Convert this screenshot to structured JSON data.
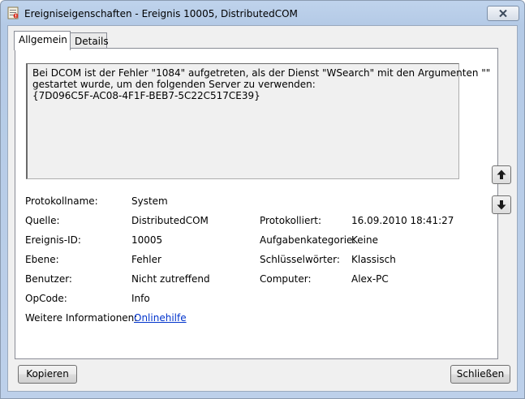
{
  "window": {
    "title": "Ereigniseigenschaften - Ereignis 10005, DistributedCOM"
  },
  "tabs": [
    {
      "label": "Allgemein",
      "active": true
    },
    {
      "label": "Details",
      "active": false
    }
  ],
  "description": {
    "lines": [
      "Bei DCOM ist der Fehler \"1084\" aufgetreten, als der Dienst \"WSearch\" mit den Argumenten \"\"",
      "gestartet wurde, um den folgenden Server zu verwenden:",
      "{7D096C5F-AC08-4F1F-BEB7-5C22C517CE39}"
    ]
  },
  "fields": {
    "protokollname": {
      "label": "Protokollname:",
      "value": "System"
    },
    "quelle": {
      "label": "Quelle:",
      "value": "DistributedCOM"
    },
    "ereignis_id": {
      "label": "Ereignis-ID:",
      "value": "10005"
    },
    "ebene": {
      "label": "Ebene:",
      "value": "Fehler"
    },
    "benutzer": {
      "label": "Benutzer:",
      "value": "Nicht zutreffend"
    },
    "opcode": {
      "label": "OpCode:",
      "value": "Info"
    },
    "weitere": {
      "label": "Weitere Informationen:",
      "value": "Onlinehilfe"
    },
    "protokolliert": {
      "label": "Protokolliert:",
      "value": "16.09.2010 18:41:27"
    },
    "aufgabenkategorie": {
      "label": "Aufgabenkategorie:",
      "value": "Keine"
    },
    "schluesselwoerter": {
      "label": "Schlüsselwörter:",
      "value": "Klassisch"
    },
    "computer": {
      "label": "Computer:",
      "value": "Alex-PC"
    }
  },
  "buttons": {
    "copy": "Kopieren",
    "close": "Schließen"
  },
  "icons": {
    "app": "event-viewer-icon",
    "close": "close-icon",
    "up": "arrow-up-icon",
    "down": "arrow-down-icon"
  },
  "colors": {
    "link": "#0033cc",
    "titlebar": "#b9cde8"
  }
}
